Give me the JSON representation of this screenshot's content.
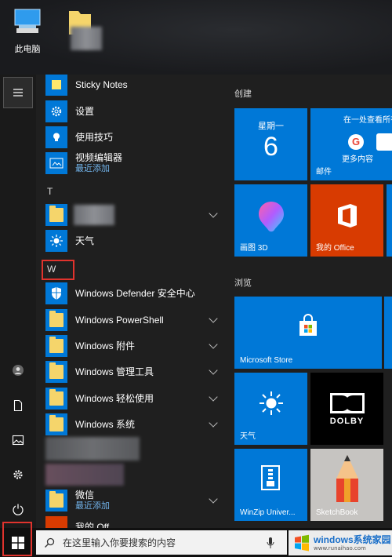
{
  "desktop": {
    "icons": [
      {
        "label": "此电脑",
        "icon": "computer-icon"
      },
      {
        "label": "",
        "icon": "folder-icon"
      }
    ]
  },
  "rail": {
    "items": [
      "hamburger-menu-icon",
      "user-icon",
      "document-icon",
      "pictures-icon",
      "settings-icon",
      "power-icon"
    ]
  },
  "app_list": {
    "items": [
      {
        "label": "Sticky Notes",
        "icon": "sticky-notes-icon"
      },
      {
        "label": "设置",
        "icon": "settings-gear-icon"
      },
      {
        "label": "使用技巧",
        "icon": "lightbulb-icon"
      },
      {
        "label": "视频编辑器",
        "sub": "最近添加",
        "icon": "video-editor-icon"
      }
    ],
    "section_t": "T",
    "t_items": [
      {
        "label": "",
        "icon": "folder-icon",
        "expandable": true
      },
      {
        "label": "天气",
        "icon": "weather-sun-icon"
      }
    ],
    "section_w": "W",
    "w_items": [
      {
        "label": "Windows Defender 安全中心",
        "icon": "shield-icon"
      },
      {
        "label": "Windows PowerShell",
        "icon": "folder-icon",
        "expandable": true
      },
      {
        "label": "Windows 附件",
        "icon": "folder-icon",
        "expandable": true
      },
      {
        "label": "Windows 管理工具",
        "icon": "folder-icon",
        "expandable": true
      },
      {
        "label": "Windows 轻松使用",
        "icon": "folder-icon",
        "expandable": true
      },
      {
        "label": "Windows 系统",
        "icon": "folder-icon",
        "expandable": true
      }
    ],
    "bottom_items": [
      {
        "label": "微信",
        "sub": "最近添加",
        "icon": "folder-icon",
        "expandable": true
      },
      {
        "label": "我的 Off",
        "icon": "office-icon"
      }
    ]
  },
  "tiles": {
    "group1": "创建",
    "group2": "浏览",
    "calendar": {
      "day": "星期一",
      "date": "6"
    },
    "mail": {
      "top": "在一处查看所有",
      "label": "邮件",
      "more": "更多内容"
    },
    "paint3d": "画图 3D",
    "office": "我的 Office",
    "store": "Microsoft Store",
    "weather": "天气",
    "dolby": "DOLBY",
    "winzip": "WinZip Univer...",
    "sketchbook": "SketchBook"
  },
  "taskbar": {
    "search_placeholder": "在这里输入你要搜索的内容",
    "watermark": "windows系统家园",
    "watermark_url": "www.runaihao.com"
  },
  "colors": {
    "accent": "#0078d7",
    "highlight": "#e0332d",
    "office_orange": "#d83b01",
    "store_blue": "#0078d7"
  }
}
